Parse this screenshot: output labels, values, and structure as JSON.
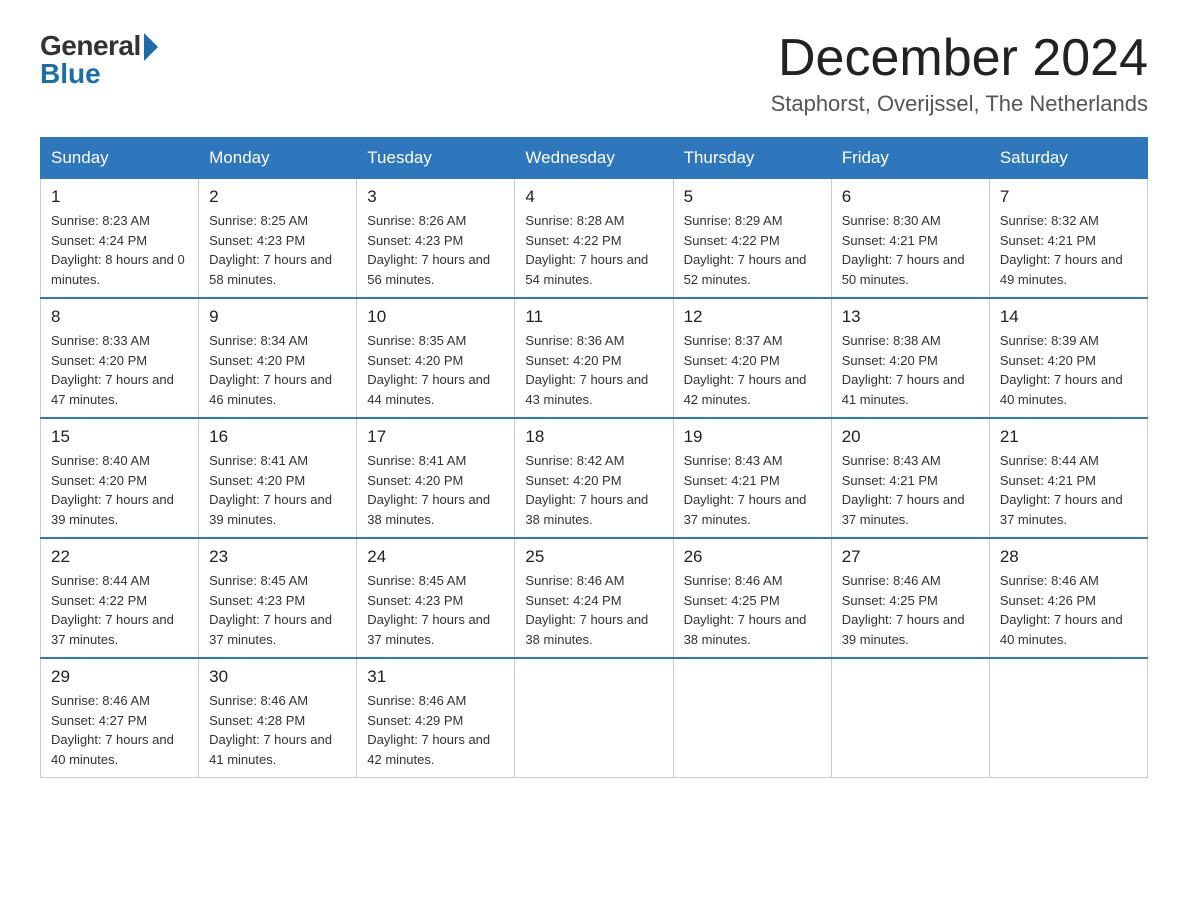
{
  "header": {
    "logo_general": "General",
    "logo_blue": "Blue",
    "month_title": "December 2024",
    "location": "Staphorst, Overijssel, The Netherlands"
  },
  "weekdays": [
    "Sunday",
    "Monday",
    "Tuesday",
    "Wednesday",
    "Thursday",
    "Friday",
    "Saturday"
  ],
  "weeks": [
    [
      {
        "day": "1",
        "sunrise": "8:23 AM",
        "sunset": "4:24 PM",
        "daylight": "8 hours and 0 minutes."
      },
      {
        "day": "2",
        "sunrise": "8:25 AM",
        "sunset": "4:23 PM",
        "daylight": "7 hours and 58 minutes."
      },
      {
        "day": "3",
        "sunrise": "8:26 AM",
        "sunset": "4:23 PM",
        "daylight": "7 hours and 56 minutes."
      },
      {
        "day": "4",
        "sunrise": "8:28 AM",
        "sunset": "4:22 PM",
        "daylight": "7 hours and 54 minutes."
      },
      {
        "day": "5",
        "sunrise": "8:29 AM",
        "sunset": "4:22 PM",
        "daylight": "7 hours and 52 minutes."
      },
      {
        "day": "6",
        "sunrise": "8:30 AM",
        "sunset": "4:21 PM",
        "daylight": "7 hours and 50 minutes."
      },
      {
        "day": "7",
        "sunrise": "8:32 AM",
        "sunset": "4:21 PM",
        "daylight": "7 hours and 49 minutes."
      }
    ],
    [
      {
        "day": "8",
        "sunrise": "8:33 AM",
        "sunset": "4:20 PM",
        "daylight": "7 hours and 47 minutes."
      },
      {
        "day": "9",
        "sunrise": "8:34 AM",
        "sunset": "4:20 PM",
        "daylight": "7 hours and 46 minutes."
      },
      {
        "day": "10",
        "sunrise": "8:35 AM",
        "sunset": "4:20 PM",
        "daylight": "7 hours and 44 minutes."
      },
      {
        "day": "11",
        "sunrise": "8:36 AM",
        "sunset": "4:20 PM",
        "daylight": "7 hours and 43 minutes."
      },
      {
        "day": "12",
        "sunrise": "8:37 AM",
        "sunset": "4:20 PM",
        "daylight": "7 hours and 42 minutes."
      },
      {
        "day": "13",
        "sunrise": "8:38 AM",
        "sunset": "4:20 PM",
        "daylight": "7 hours and 41 minutes."
      },
      {
        "day": "14",
        "sunrise": "8:39 AM",
        "sunset": "4:20 PM",
        "daylight": "7 hours and 40 minutes."
      }
    ],
    [
      {
        "day": "15",
        "sunrise": "8:40 AM",
        "sunset": "4:20 PM",
        "daylight": "7 hours and 39 minutes."
      },
      {
        "day": "16",
        "sunrise": "8:41 AM",
        "sunset": "4:20 PM",
        "daylight": "7 hours and 39 minutes."
      },
      {
        "day": "17",
        "sunrise": "8:41 AM",
        "sunset": "4:20 PM",
        "daylight": "7 hours and 38 minutes."
      },
      {
        "day": "18",
        "sunrise": "8:42 AM",
        "sunset": "4:20 PM",
        "daylight": "7 hours and 38 minutes."
      },
      {
        "day": "19",
        "sunrise": "8:43 AM",
        "sunset": "4:21 PM",
        "daylight": "7 hours and 37 minutes."
      },
      {
        "day": "20",
        "sunrise": "8:43 AM",
        "sunset": "4:21 PM",
        "daylight": "7 hours and 37 minutes."
      },
      {
        "day": "21",
        "sunrise": "8:44 AM",
        "sunset": "4:21 PM",
        "daylight": "7 hours and 37 minutes."
      }
    ],
    [
      {
        "day": "22",
        "sunrise": "8:44 AM",
        "sunset": "4:22 PM",
        "daylight": "7 hours and 37 minutes."
      },
      {
        "day": "23",
        "sunrise": "8:45 AM",
        "sunset": "4:23 PM",
        "daylight": "7 hours and 37 minutes."
      },
      {
        "day": "24",
        "sunrise": "8:45 AM",
        "sunset": "4:23 PM",
        "daylight": "7 hours and 37 minutes."
      },
      {
        "day": "25",
        "sunrise": "8:46 AM",
        "sunset": "4:24 PM",
        "daylight": "7 hours and 38 minutes."
      },
      {
        "day": "26",
        "sunrise": "8:46 AM",
        "sunset": "4:25 PM",
        "daylight": "7 hours and 38 minutes."
      },
      {
        "day": "27",
        "sunrise": "8:46 AM",
        "sunset": "4:25 PM",
        "daylight": "7 hours and 39 minutes."
      },
      {
        "day": "28",
        "sunrise": "8:46 AM",
        "sunset": "4:26 PM",
        "daylight": "7 hours and 40 minutes."
      }
    ],
    [
      {
        "day": "29",
        "sunrise": "8:46 AM",
        "sunset": "4:27 PM",
        "daylight": "7 hours and 40 minutes."
      },
      {
        "day": "30",
        "sunrise": "8:46 AM",
        "sunset": "4:28 PM",
        "daylight": "7 hours and 41 minutes."
      },
      {
        "day": "31",
        "sunrise": "8:46 AM",
        "sunset": "4:29 PM",
        "daylight": "7 hours and 42 minutes."
      },
      null,
      null,
      null,
      null
    ]
  ]
}
